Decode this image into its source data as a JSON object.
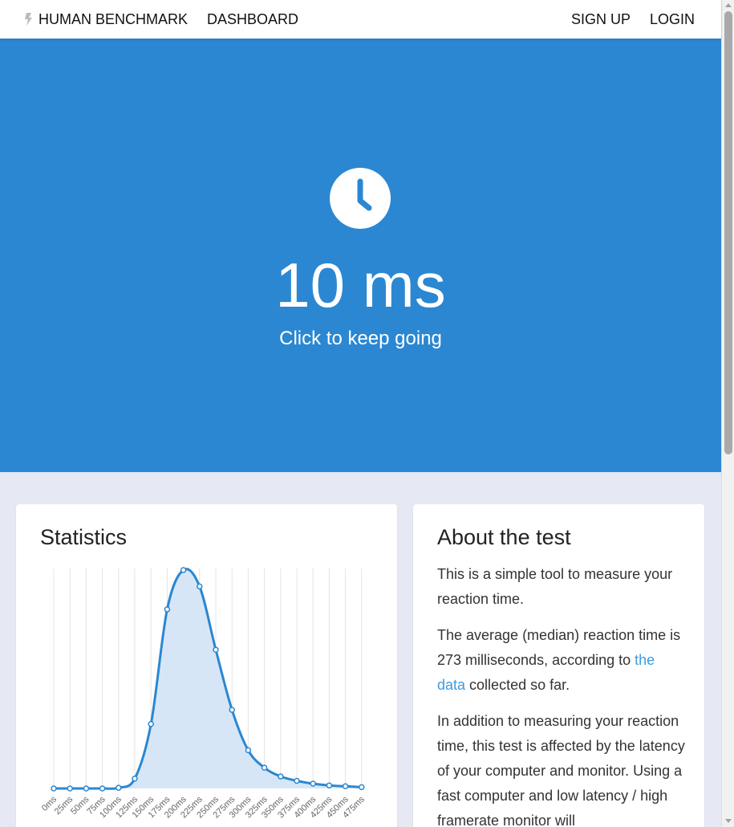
{
  "nav": {
    "logo_icon": "bolt-icon",
    "brand": "HUMAN BENCHMARK",
    "dashboard": "DASHBOARD",
    "signup": "SIGN UP",
    "login": "LOGIN"
  },
  "hero": {
    "icon": "clock-icon",
    "result": "10 ms",
    "prompt": "Click to keep going",
    "bg_color": "#2b87d1"
  },
  "stats": {
    "title": "Statistics"
  },
  "about": {
    "title": "About the test",
    "p1": "This is a simple tool to measure your reaction time.",
    "p2_before": "The average (median) reaction time is 273 milliseconds, according to ",
    "p2_link": "the data",
    "p2_after": " collected so far.",
    "p3": "In addition to measuring your reaction time, this test is affected by the latency of your computer and monitor. Using a fast computer and low latency / high framerate monitor will"
  },
  "chart_data": {
    "type": "area",
    "categories": [
      "0ms",
      "25ms",
      "50ms",
      "75ms",
      "100ms",
      "125ms",
      "150ms",
      "175ms",
      "200ms",
      "225ms",
      "250ms",
      "275ms",
      "300ms",
      "325ms",
      "350ms",
      "375ms",
      "400ms",
      "425ms",
      "450ms",
      "475ms"
    ],
    "values": [
      0.0,
      0.0,
      0.0,
      0.0,
      0.3,
      4.5,
      29.5,
      82.0,
      100.0,
      92.5,
      63.5,
      36.0,
      17.5,
      9.5,
      5.5,
      3.5,
      2.2,
      1.4,
      1.0,
      0.6
    ],
    "ylim": [
      0,
      100
    ],
    "grid": true,
    "line_color": "#2b87d1",
    "fill_color": "#d5e5f5"
  }
}
